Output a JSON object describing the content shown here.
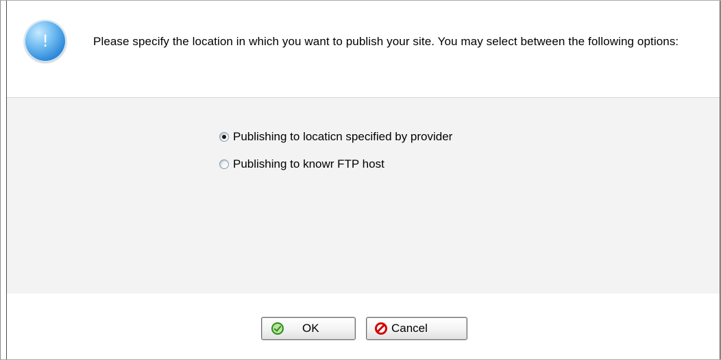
{
  "dialog": {
    "message": "Please specify the location in which you want to publish your site. You may select between the following options:",
    "icon": "info-icon",
    "icon_glyph": "!"
  },
  "options": [
    {
      "label": "Publishing to locaticn specified by provider",
      "selected": true
    },
    {
      "label": "Publishing to knowr FTP host",
      "selected": false
    }
  ],
  "buttons": {
    "ok": {
      "label": "OK",
      "icon": "check-icon"
    },
    "cancel": {
      "label": "Cancel",
      "icon": "cancel-icon"
    }
  },
  "colors": {
    "middle_background": "#f3f3f3",
    "info_icon": "#2f8ad9",
    "ok_icon": "#2b8a1f",
    "cancel_icon": "#d40000"
  }
}
